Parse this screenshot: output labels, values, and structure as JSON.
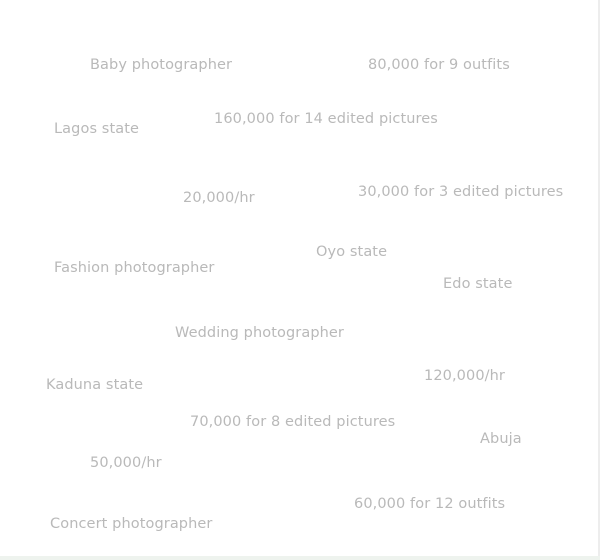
{
  "tags": [
    "Baby photographer",
    "80,000 for 9 outfits",
    "Lagos state",
    "160,000 for 14 edited pictures",
    "20,000/hr",
    "30,000 for 3 edited pictures",
    "Oyo state",
    "Fashion photographer",
    "Edo state",
    "Wedding photographer",
    "120,000/hr",
    "Kaduna state",
    "70,000 for 8 edited pictures",
    "Abuja",
    "50,000/hr",
    "60,000 for 12 outfits",
    "Concert photographer"
  ],
  "colors": {
    "text": "#b9b9b9",
    "background": "#ffffff"
  }
}
